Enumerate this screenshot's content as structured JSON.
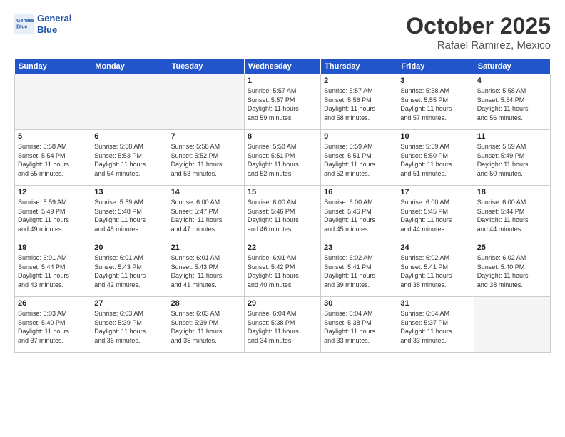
{
  "header": {
    "logo_line1": "General",
    "logo_line2": "Blue",
    "month": "October 2025",
    "location": "Rafael Ramirez, Mexico"
  },
  "days_of_week": [
    "Sunday",
    "Monday",
    "Tuesday",
    "Wednesday",
    "Thursday",
    "Friday",
    "Saturday"
  ],
  "weeks": [
    [
      {
        "day": "",
        "info": ""
      },
      {
        "day": "",
        "info": ""
      },
      {
        "day": "",
        "info": ""
      },
      {
        "day": "1",
        "info": "Sunrise: 5:57 AM\nSunset: 5:57 PM\nDaylight: 11 hours\nand 59 minutes."
      },
      {
        "day": "2",
        "info": "Sunrise: 5:57 AM\nSunset: 5:56 PM\nDaylight: 11 hours\nand 58 minutes."
      },
      {
        "day": "3",
        "info": "Sunrise: 5:58 AM\nSunset: 5:55 PM\nDaylight: 11 hours\nand 57 minutes."
      },
      {
        "day": "4",
        "info": "Sunrise: 5:58 AM\nSunset: 5:54 PM\nDaylight: 11 hours\nand 56 minutes."
      }
    ],
    [
      {
        "day": "5",
        "info": "Sunrise: 5:58 AM\nSunset: 5:54 PM\nDaylight: 11 hours\nand 55 minutes."
      },
      {
        "day": "6",
        "info": "Sunrise: 5:58 AM\nSunset: 5:53 PM\nDaylight: 11 hours\nand 54 minutes."
      },
      {
        "day": "7",
        "info": "Sunrise: 5:58 AM\nSunset: 5:52 PM\nDaylight: 11 hours\nand 53 minutes."
      },
      {
        "day": "8",
        "info": "Sunrise: 5:58 AM\nSunset: 5:51 PM\nDaylight: 11 hours\nand 52 minutes."
      },
      {
        "day": "9",
        "info": "Sunrise: 5:59 AM\nSunset: 5:51 PM\nDaylight: 11 hours\nand 52 minutes."
      },
      {
        "day": "10",
        "info": "Sunrise: 5:59 AM\nSunset: 5:50 PM\nDaylight: 11 hours\nand 51 minutes."
      },
      {
        "day": "11",
        "info": "Sunrise: 5:59 AM\nSunset: 5:49 PM\nDaylight: 11 hours\nand 50 minutes."
      }
    ],
    [
      {
        "day": "12",
        "info": "Sunrise: 5:59 AM\nSunset: 5:49 PM\nDaylight: 11 hours\nand 49 minutes."
      },
      {
        "day": "13",
        "info": "Sunrise: 5:59 AM\nSunset: 5:48 PM\nDaylight: 11 hours\nand 48 minutes."
      },
      {
        "day": "14",
        "info": "Sunrise: 6:00 AM\nSunset: 5:47 PM\nDaylight: 11 hours\nand 47 minutes."
      },
      {
        "day": "15",
        "info": "Sunrise: 6:00 AM\nSunset: 5:46 PM\nDaylight: 11 hours\nand 46 minutes."
      },
      {
        "day": "16",
        "info": "Sunrise: 6:00 AM\nSunset: 5:46 PM\nDaylight: 11 hours\nand 45 minutes."
      },
      {
        "day": "17",
        "info": "Sunrise: 6:00 AM\nSunset: 5:45 PM\nDaylight: 11 hours\nand 44 minutes."
      },
      {
        "day": "18",
        "info": "Sunrise: 6:00 AM\nSunset: 5:44 PM\nDaylight: 11 hours\nand 44 minutes."
      }
    ],
    [
      {
        "day": "19",
        "info": "Sunrise: 6:01 AM\nSunset: 5:44 PM\nDaylight: 11 hours\nand 43 minutes."
      },
      {
        "day": "20",
        "info": "Sunrise: 6:01 AM\nSunset: 5:43 PM\nDaylight: 11 hours\nand 42 minutes."
      },
      {
        "day": "21",
        "info": "Sunrise: 6:01 AM\nSunset: 5:43 PM\nDaylight: 11 hours\nand 41 minutes."
      },
      {
        "day": "22",
        "info": "Sunrise: 6:01 AM\nSunset: 5:42 PM\nDaylight: 11 hours\nand 40 minutes."
      },
      {
        "day": "23",
        "info": "Sunrise: 6:02 AM\nSunset: 5:41 PM\nDaylight: 11 hours\nand 39 minutes."
      },
      {
        "day": "24",
        "info": "Sunrise: 6:02 AM\nSunset: 5:41 PM\nDaylight: 11 hours\nand 38 minutes."
      },
      {
        "day": "25",
        "info": "Sunrise: 6:02 AM\nSunset: 5:40 PM\nDaylight: 11 hours\nand 38 minutes."
      }
    ],
    [
      {
        "day": "26",
        "info": "Sunrise: 6:03 AM\nSunset: 5:40 PM\nDaylight: 11 hours\nand 37 minutes."
      },
      {
        "day": "27",
        "info": "Sunrise: 6:03 AM\nSunset: 5:39 PM\nDaylight: 11 hours\nand 36 minutes."
      },
      {
        "day": "28",
        "info": "Sunrise: 6:03 AM\nSunset: 5:39 PM\nDaylight: 11 hours\nand 35 minutes."
      },
      {
        "day": "29",
        "info": "Sunrise: 6:04 AM\nSunset: 5:38 PM\nDaylight: 11 hours\nand 34 minutes."
      },
      {
        "day": "30",
        "info": "Sunrise: 6:04 AM\nSunset: 5:38 PM\nDaylight: 11 hours\nand 33 minutes."
      },
      {
        "day": "31",
        "info": "Sunrise: 6:04 AM\nSunset: 5:37 PM\nDaylight: 11 hours\nand 33 minutes."
      },
      {
        "day": "",
        "info": ""
      }
    ]
  ]
}
